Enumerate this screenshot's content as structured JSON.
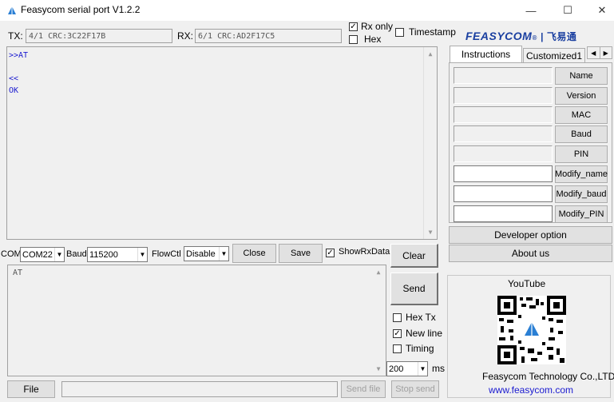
{
  "window": {
    "title": "Feasycom serial port V1.2.2",
    "min": "—",
    "max": "☐",
    "close": "✕"
  },
  "counters": {
    "tx_label": "TX:",
    "tx_value": "4/1 CRC:3C22F17B",
    "rx_label": "RX:",
    "rx_value": "6/1 CRC:AD2F17C5"
  },
  "options_top": {
    "rx_only": "Rx only",
    "hex": "Hex",
    "timestamp": "Timestamp"
  },
  "brand": {
    "logo_text": "FEASYCOM",
    "logo_cn": "飞易通",
    "color": "#1a3fa0"
  },
  "terminal": {
    "lines": [
      ">>AT",
      "",
      "<<",
      "OK"
    ],
    "color": "#1a1ad0"
  },
  "tabs": [
    {
      "label": "Instructions"
    },
    {
      "label": "Customized1"
    }
  ],
  "commands": [
    {
      "label": "Name"
    },
    {
      "label": "Version"
    },
    {
      "label": "MAC"
    },
    {
      "label": "Baud"
    },
    {
      "label": "PIN"
    },
    {
      "label": "Modify_name"
    },
    {
      "label": "Modify_baud"
    },
    {
      "label": "Modify_PIN"
    }
  ],
  "side_buttons": {
    "developer": "Developer option",
    "about": "About us"
  },
  "controls": {
    "com_label": "COM",
    "com_value": "COM22",
    "baud_label": "Baud",
    "baud_value": "115200",
    "flow_label": "FlowCtl",
    "flow_value": "Disable",
    "close": "Close",
    "save": "Save",
    "show_rx": "ShowRxData",
    "clear": "Clear"
  },
  "send_box": {
    "text": "AT"
  },
  "send_panel": {
    "send": "Send",
    "hex_tx": "Hex Tx",
    "new_line": "New line",
    "timing": "Timing",
    "interval": "200",
    "unit": "ms"
  },
  "bottom": {
    "file": "File",
    "send_file": "Send file",
    "stop_send": "Stop send"
  },
  "promo": {
    "youtube": "YouTube",
    "company": "Feasycom Technology Co.,LTD",
    "url": "www.feasycom.com"
  }
}
